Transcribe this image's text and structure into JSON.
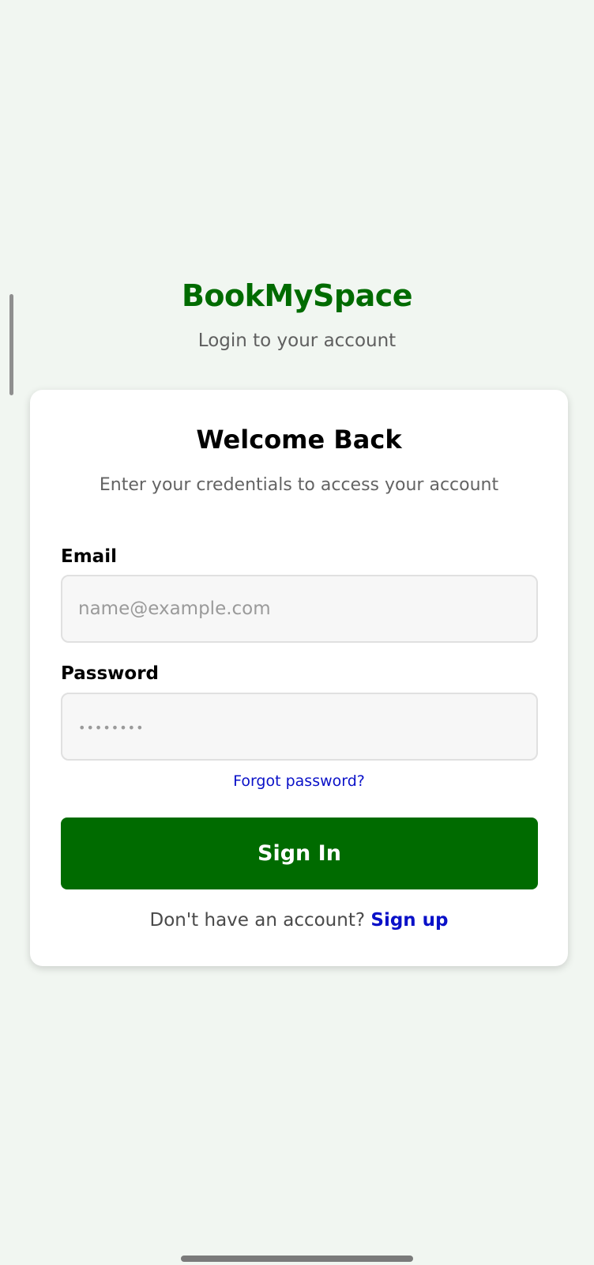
{
  "app": {
    "brand_name": "BookMySpace",
    "subtitle": "Login to your account"
  },
  "card": {
    "title": "Welcome Back",
    "subtitle": "Enter your credentials to access your account"
  },
  "form": {
    "email_label": "Email",
    "email_placeholder": "name@example.com",
    "email_value": "",
    "password_label": "Password",
    "password_placeholder": "••••••••",
    "password_value": "",
    "forgot_label": "Forgot password?",
    "submit_label": "Sign In"
  },
  "footer": {
    "prompt_text": "Don't have an account? ",
    "signup_label": "Sign up"
  },
  "colors": {
    "brand_green": "#006b00",
    "link_blue": "#0a11c8",
    "background": "#f1f6f1"
  }
}
